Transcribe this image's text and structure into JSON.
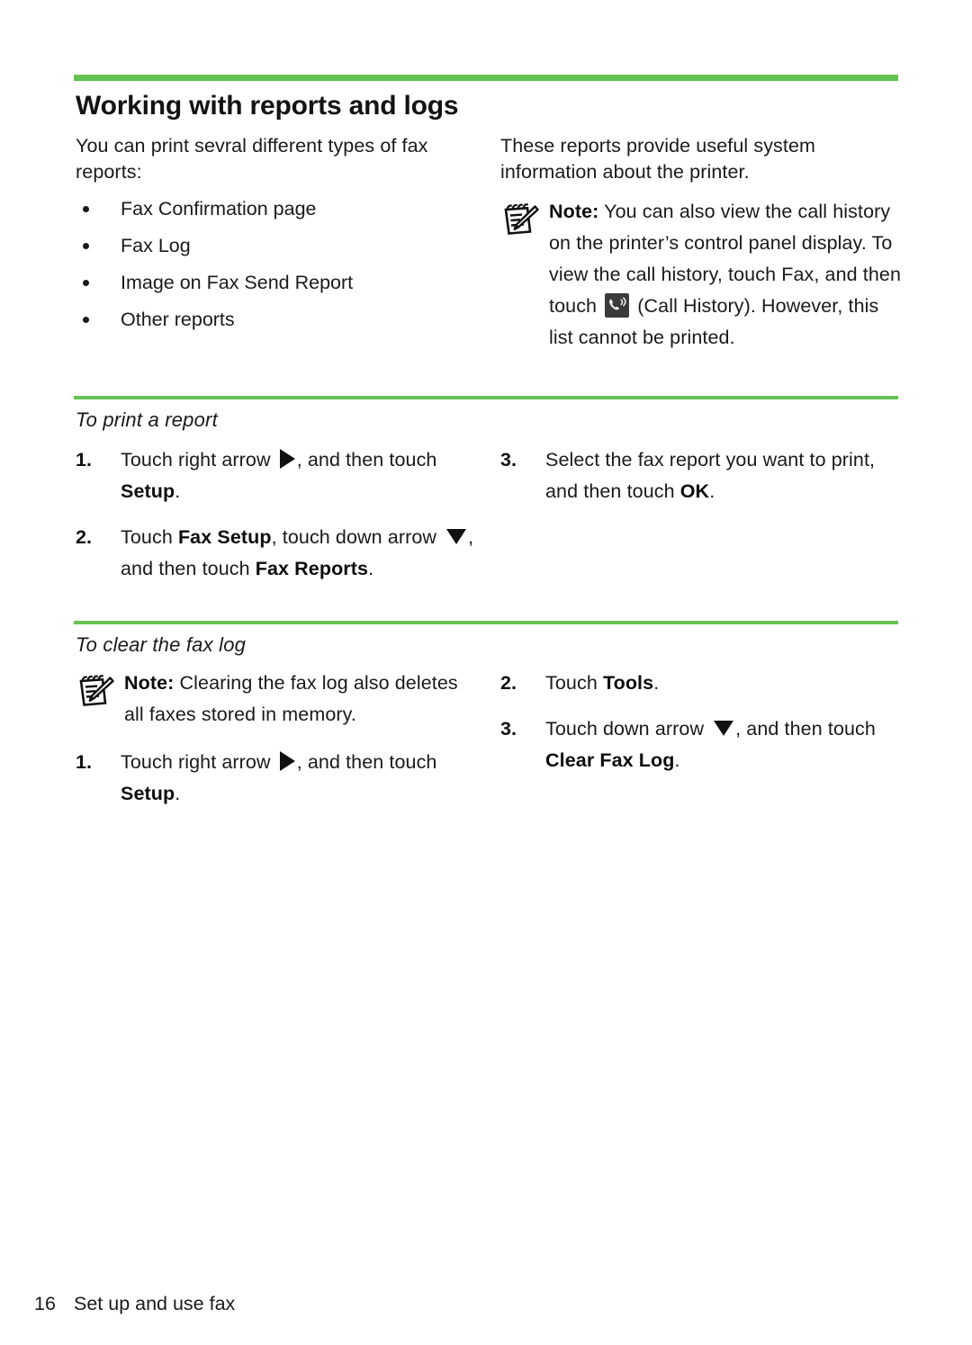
{
  "theme": {
    "accent_green": "#64c254",
    "text": "#1a1a1a",
    "background": "#ffffff"
  },
  "section": {
    "heading": "Working with reports and logs",
    "intro_left": "You can print sevral different types of fax reports:",
    "intro_right": "These reports provide useful system information about the printer.",
    "bullets": [
      "Fax Confirmation page",
      "Fax Log",
      "Image on Fax Send Report",
      "Other reports"
    ],
    "note": {
      "icon": "note-pad-pencil-icon",
      "label": "Note:",
      "part1": " You can also view the call history on the printer’s control panel display. To view the call history, touch Fax, and then touch ",
      "call_history_icon": "call-history-icon",
      "part2": " (Call History). However, this list cannot be printed."
    }
  },
  "procedure_print": {
    "heading": "To print a report",
    "steps": [
      {
        "number": "1.",
        "pre": "Touch right arrow ",
        "icon": "right-arrow-icon",
        "mid": ", and then touch ",
        "bold": "Setup",
        "post": "."
      },
      {
        "number": "2.",
        "pre": "Touch ",
        "bold1": "Fax Setup",
        "mid1": ", touch down arrow ",
        "icon": "down-arrow-icon",
        "mid2": ", and then touch ",
        "bold2": "Fax Reports",
        "post": "."
      },
      {
        "number": "3.",
        "pre": "Select the fax report you want to print, and then touch ",
        "bold": "OK",
        "post": "."
      }
    ]
  },
  "procedure_clear": {
    "heading": "To clear the fax log",
    "note": {
      "icon": "note-pad-pencil-icon",
      "label": "Note:",
      "text": " Clearing the fax log also deletes all faxes stored in memory."
    },
    "steps": [
      {
        "number": "1.",
        "pre": "Touch right arrow ",
        "icon": "right-arrow-icon",
        "mid": ", and then touch ",
        "bold": "Setup",
        "post": "."
      },
      {
        "number": "2.",
        "pre": "Touch ",
        "bold": "Tools",
        "post": "."
      },
      {
        "number": "3.",
        "pre": "Touch down arrow ",
        "icon": "down-arrow-icon",
        "mid": ", and then touch ",
        "bold": "Clear Fax Log",
        "post": "."
      }
    ]
  },
  "footer": {
    "page_number": "16",
    "chapter": "Set up and use fax"
  }
}
